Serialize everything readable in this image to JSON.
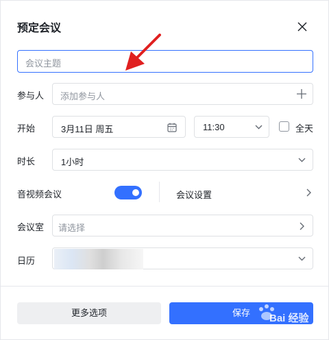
{
  "dialog": {
    "title": "预定会议"
  },
  "subject": {
    "placeholder": "会议主题"
  },
  "participants": {
    "label": "参与人",
    "placeholder": "添加参与人"
  },
  "start": {
    "label": "开始",
    "date": "3月11日 周五",
    "time": "11:30",
    "all_day_label": "全天"
  },
  "duration": {
    "label": "时长",
    "value": "1小时"
  },
  "video": {
    "label": "音视频会议",
    "enabled": true,
    "settings_label": "会议设置"
  },
  "room": {
    "label": "会议室",
    "placeholder": "请选择"
  },
  "calendar": {
    "label": "日历"
  },
  "footer": {
    "more_label": "更多选项",
    "save_label": "保存"
  },
  "watermark": {
    "text": "Bai 经验"
  },
  "colors": {
    "accent": "#3370ff",
    "annotation_arrow": "#e02020"
  }
}
